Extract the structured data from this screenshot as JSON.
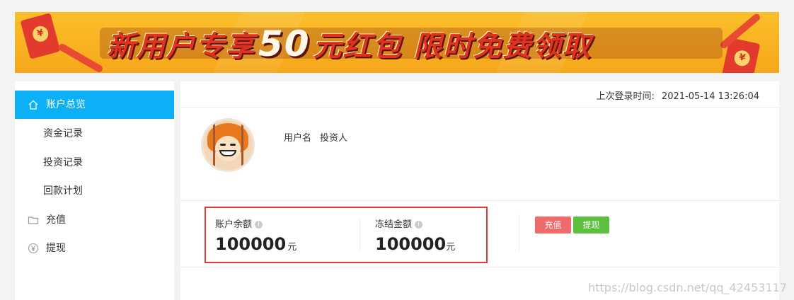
{
  "banner": {
    "title_part1": "新用户专享",
    "title_big": "50",
    "title_part2": "元红包 限时免费领取",
    "packet_symbol": "¥"
  },
  "sidebar": {
    "items": [
      {
        "label": "账户总览",
        "icon": "home-icon",
        "active": true
      },
      {
        "label": "资金记录",
        "icon": "",
        "active": false
      },
      {
        "label": "投资记录",
        "icon": "",
        "active": false
      },
      {
        "label": "回款计划",
        "icon": "",
        "active": false
      },
      {
        "label": "充值",
        "icon": "folder-icon",
        "active": false
      },
      {
        "label": "提现",
        "icon": "yen-icon",
        "active": false
      }
    ]
  },
  "main": {
    "last_login_label": "上次登录时间:",
    "last_login_value": "2021-05-14 13:26:04",
    "username_label": "用户名",
    "username_value": "投资人",
    "balance": {
      "label": "账户余额",
      "amount": "100000",
      "unit": "元"
    },
    "frozen": {
      "label": "冻结金额",
      "amount": "100000",
      "unit": "元"
    },
    "recharge_button": "充值",
    "withdraw_button": "提现"
  },
  "watermark": "https://blog.csdn.net/qq_42453117",
  "colors": {
    "accent": "#0cb0f7",
    "recharge": "#ef6b6b",
    "withdraw": "#5cbf3e",
    "highlight_border": "#e03a3a",
    "banner": "#f6a81a"
  }
}
